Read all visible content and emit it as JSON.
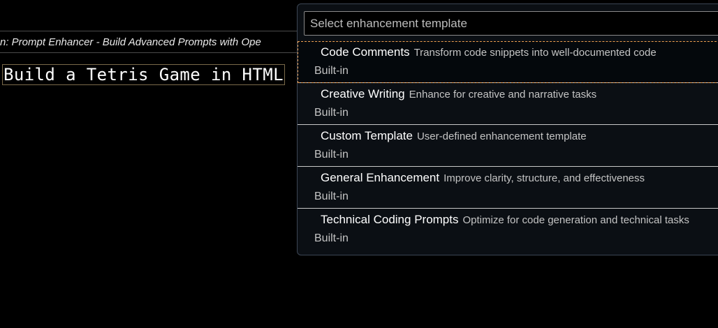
{
  "editor": {
    "tab_title": "n: Prompt Enhancer - Build Advanced Prompts with Ope",
    "selected_text": "Build a Tetris Game in HTML"
  },
  "quick_pick": {
    "placeholder": "Select enhancement template",
    "items": [
      {
        "label": "Code Comments",
        "description": "Transform code snippets into well-documented code",
        "detail": "Built-in",
        "active": true
      },
      {
        "label": "Creative Writing",
        "description": "Enhance for creative and narrative tasks",
        "detail": "Built-in",
        "active": false
      },
      {
        "label": "Custom Template",
        "description": "User-defined enhancement template",
        "detail": "Built-in",
        "active": false
      },
      {
        "label": "General Enhancement",
        "description": "Improve clarity, structure, and effectiveness",
        "detail": "Built-in",
        "active": false
      },
      {
        "label": "Technical Coding Prompts",
        "description": "Optimize for code generation and technical tasks",
        "detail": "Built-in",
        "active": false
      }
    ]
  },
  "colors": {
    "background": "#000000",
    "focus_border": "#f0a050",
    "widget_border": "#3c4654"
  }
}
